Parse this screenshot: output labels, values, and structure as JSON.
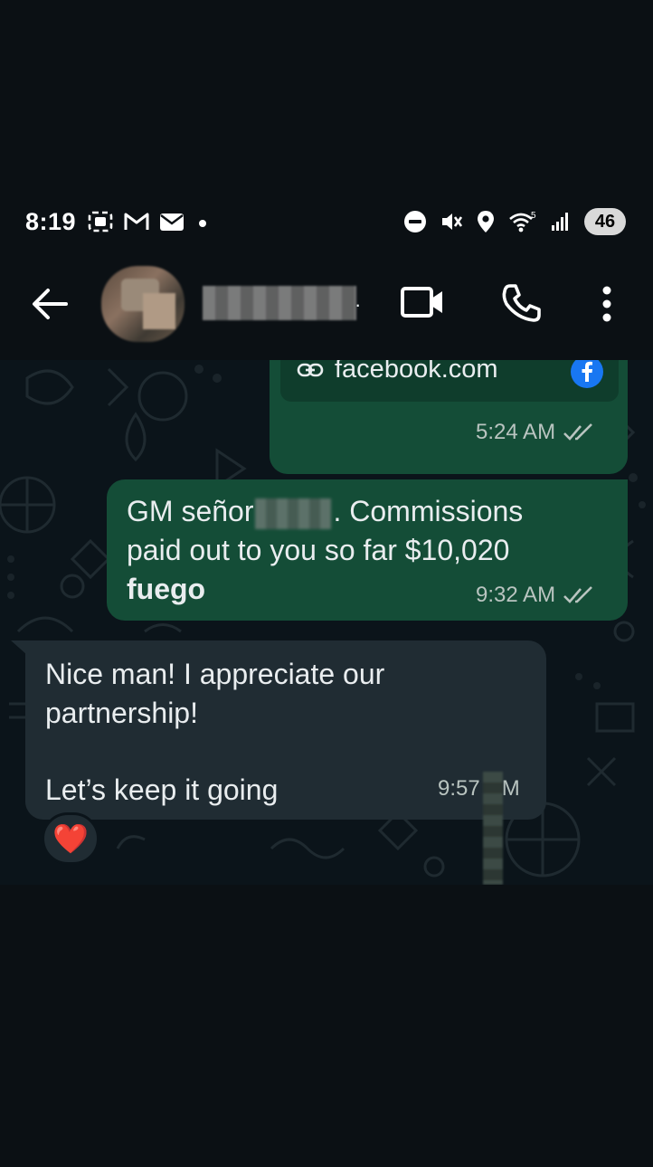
{
  "status_bar": {
    "time": "8:19",
    "battery": "46",
    "left_icons": [
      "screenshot-icon",
      "gmail-icon",
      "mail-icon",
      "notification-dot-icon"
    ],
    "right_icons": [
      "dnd-icon",
      "vibrate-mute-icon",
      "location-icon",
      "wifi-5g-icon",
      "signal-icon"
    ]
  },
  "header": {
    "contact_name": "",
    "actions": [
      "video-call-icon",
      "phone-call-icon",
      "more-options-icon"
    ]
  },
  "messages": {
    "link_bubble": {
      "url_text": "facebook.com",
      "time": "5:24 AM"
    },
    "outgoing": {
      "line1_a": "GM señor",
      "line1_b": ". Commissions",
      "line2": "paid out to you so far $10,020",
      "line3": "fuego",
      "time": "9:32 AM"
    },
    "incoming": {
      "line1": "Nice man! I appreciate our",
      "line2": "partnership!",
      "line3": "Let’s keep it going",
      "time_a": "9:57",
      "time_b": "AM",
      "reaction": "❤️"
    }
  },
  "colors": {
    "background": "#0b1014",
    "chat_background": "#0b141a",
    "outgoing_bubble": "#144d37",
    "incoming_bubble": "#202c33",
    "read_ticks": "#b9c4c0",
    "facebook_blue": "#1877f2"
  }
}
